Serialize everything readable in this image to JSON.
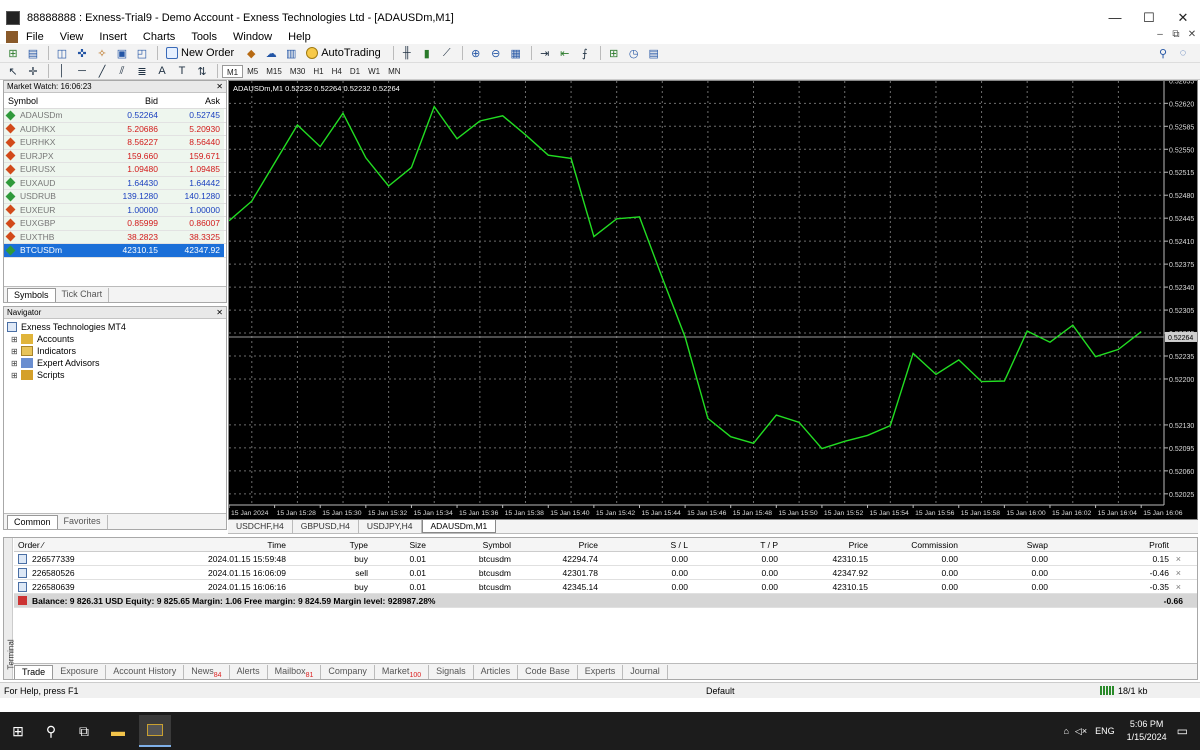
{
  "window": {
    "title": "88888888 : Exness-Trial9 - Demo Account - Exness Technologies Ltd - [ADAUSDm,M1]",
    "controls": [
      "—",
      "☐",
      "✕"
    ]
  },
  "menu": [
    "File",
    "View",
    "Insert",
    "Charts",
    "Tools",
    "Window",
    "Help"
  ],
  "toolbar": {
    "new_order": "New Order",
    "autotrading": "AutoTrading",
    "timeframes": [
      "M1",
      "M5",
      "M15",
      "M30",
      "H1",
      "H4",
      "D1",
      "W1",
      "MN"
    ]
  },
  "market_watch": {
    "title": "Market Watch: 16:06:23",
    "columns": [
      "Symbol",
      "Bid",
      "Ask"
    ],
    "rows": [
      {
        "symbol": "ADAUSDm",
        "bid": "0.52264",
        "ask": "0.52745",
        "color": "#2e9a3a",
        "bid_color": "#1a3fbf",
        "ask_color": "#1a3fbf"
      },
      {
        "symbol": "AUDHKX",
        "bid": "5.20686",
        "ask": "5.20930",
        "color": "#d24a1a",
        "bid_color": "#d21a1a",
        "ask_color": "#d21a1a"
      },
      {
        "symbol": "EURHKX",
        "bid": "8.56227",
        "ask": "8.56440",
        "color": "#d24a1a",
        "bid_color": "#d21a1a",
        "ask_color": "#d21a1a"
      },
      {
        "symbol": "EURJPX",
        "bid": "159.660",
        "ask": "159.671",
        "color": "#d24a1a",
        "bid_color": "#d21a1a",
        "ask_color": "#d21a1a"
      },
      {
        "symbol": "EURUSX",
        "bid": "1.09480",
        "ask": "1.09485",
        "color": "#d24a1a",
        "bid_color": "#d21a1a",
        "ask_color": "#d21a1a"
      },
      {
        "symbol": "EUXAUD",
        "bid": "1.64430",
        "ask": "1.64442",
        "color": "#2e9a3a",
        "bid_color": "#1a3fbf",
        "ask_color": "#1a3fbf"
      },
      {
        "symbol": "USDRUB",
        "bid": "139.1280",
        "ask": "140.1280",
        "color": "#2e9a3a",
        "bid_color": "#1a3fbf",
        "ask_color": "#1a3fbf"
      },
      {
        "symbol": "EUXEUR",
        "bid": "1.00000",
        "ask": "1.00000",
        "color": "#d24a1a",
        "bid_color": "#1a3fbf",
        "ask_color": "#1a3fbf"
      },
      {
        "symbol": "EUXGBP",
        "bid": "0.85999",
        "ask": "0.86007",
        "color": "#d24a1a",
        "bid_color": "#d21a1a",
        "ask_color": "#d21a1a"
      },
      {
        "symbol": "EUXTHB",
        "bid": "38.2823",
        "ask": "38.3325",
        "color": "#d24a1a",
        "bid_color": "#d21a1a",
        "ask_color": "#d21a1a"
      },
      {
        "symbol": "BTCUSDm",
        "bid": "42310.15",
        "ask": "42347.92",
        "color": "#2e9a3a",
        "bid_color": "#ffffff",
        "ask_color": "#ffffff",
        "selected": true
      }
    ],
    "tabs": [
      "Symbols",
      "Tick Chart"
    ]
  },
  "navigator": {
    "title": "Navigator",
    "root": "Exness Technologies MT4",
    "items": [
      "Accounts",
      "Indicators",
      "Expert Advisors",
      "Scripts"
    ],
    "tabs": [
      "Common",
      "Favorites"
    ]
  },
  "chart": {
    "header": "ADAUSDm,M1  0.52232 0.52264 0.52232 0.52264",
    "current_price": "0.52264",
    "line_color": "#22dd22"
  },
  "chart_data": {
    "type": "line",
    "ylim": [
      0.52008,
      0.52654
    ],
    "y_ticks": [
      "0.52655",
      "0.52620",
      "0.52585",
      "0.52550",
      "0.52515",
      "0.52480",
      "0.52445",
      "0.52410",
      "0.52375",
      "0.52340",
      "0.52305",
      "0.52270",
      "0.52235",
      "0.52200",
      "0.52130",
      "0.52095",
      "0.52060",
      "0.52025"
    ],
    "y_tick_values": [
      0.52655,
      0.5262,
      0.52585,
      0.5255,
      0.52515,
      0.5248,
      0.52445,
      0.5241,
      0.52375,
      0.5234,
      0.52305,
      0.5227,
      0.52235,
      0.522,
      0.5213,
      0.52095,
      0.5206,
      0.52025
    ],
    "x_ticks": [
      "15 Jan 2024",
      "15 Jan 15:28",
      "15 Jan 15:30",
      "15 Jan 15:32",
      "15 Jan 15:34",
      "15 Jan 15:36",
      "15 Jan 15:38",
      "15 Jan 15:40",
      "15 Jan 15:42",
      "15 Jan 15:44",
      "15 Jan 15:46",
      "15 Jan 15:48",
      "15 Jan 15:50",
      "15 Jan 15:52",
      "15 Jan 15:54",
      "15 Jan 15:56",
      "15 Jan 15:58",
      "15 Jan 16:00",
      "15 Jan 16:02",
      "15 Jan 16:04",
      "15 Jan 16:06"
    ],
    "x_minutes": [
      "15:25",
      "15:26",
      "15:27",
      "15:28",
      "15:29",
      "15:30",
      "15:31",
      "15:32",
      "15:33",
      "15:34",
      "15:35",
      "15:36",
      "15:37",
      "15:38",
      "15:39",
      "15:40",
      "15:41",
      "15:42",
      "15:43",
      "15:44",
      "15:45",
      "15:46",
      "15:47",
      "15:48",
      "15:49",
      "15:50",
      "15:51",
      "15:52",
      "15:53",
      "15:54",
      "15:55",
      "15:56",
      "15:57",
      "15:58",
      "15:59",
      "16:00",
      "16:01",
      "16:02",
      "16:03",
      "16:04",
      "16:05",
      "16:06"
    ],
    "values": [
      0.52441,
      0.52471,
      0.52529,
      0.52587,
      0.52554,
      0.52605,
      0.52537,
      0.52494,
      0.52522,
      0.52615,
      0.52566,
      0.52593,
      0.52601,
      0.52572,
      0.52541,
      0.52536,
      0.52417,
      0.52444,
      0.52447,
      0.52354,
      0.52264,
      0.5214,
      0.52112,
      0.52102,
      0.52145,
      0.52134,
      0.52094,
      0.52105,
      0.52114,
      0.52129,
      0.52239,
      0.52207,
      0.52229,
      0.52196,
      0.52197,
      0.52273,
      0.52256,
      0.52282,
      0.52234,
      0.52245,
      0.52272
    ],
    "grid": true
  },
  "chart_tabs": [
    "USDCHF,H4",
    "GBPUSD,H4",
    "USDJPY,H4",
    "ADAUSDm,M1"
  ],
  "terminal": {
    "side_label": "Terminal",
    "columns": [
      "Order",
      "Time",
      "Type",
      "Size",
      "Symbol",
      "Price",
      "S / L",
      "T / P",
      "Price",
      "Commission",
      "Swap",
      "Profit"
    ],
    "rows": [
      {
        "order": "226577339",
        "time": "2024.01.15 15:59:48",
        "type": "buy",
        "size": "0.01",
        "symbol": "btcusdm",
        "price": "42294.74",
        "sl": "0.00",
        "tp": "0.00",
        "price2": "42310.15",
        "commission": "0.00",
        "swap": "0.00",
        "profit": "0.15"
      },
      {
        "order": "226580526",
        "time": "2024.01.15 16:06:09",
        "type": "sell",
        "size": "0.01",
        "symbol": "btcusdm",
        "price": "42301.78",
        "sl": "0.00",
        "tp": "0.00",
        "price2": "42347.92",
        "commission": "0.00",
        "swap": "0.00",
        "profit": "-0.46"
      },
      {
        "order": "226580639",
        "time": "2024.01.15 16:06:16",
        "type": "buy",
        "size": "0.01",
        "symbol": "btcusdm",
        "price": "42345.14",
        "sl": "0.00",
        "tp": "0.00",
        "price2": "42310.15",
        "commission": "0.00",
        "swap": "0.00",
        "profit": "-0.35"
      }
    ],
    "balance_line": "Balance: 9 826.31 USD  Equity: 9 825.65  Margin: 1.06  Free margin: 9 824.59  Margin level: 928987.28%",
    "total_profit": "-0.66",
    "tabs": [
      {
        "label": "Trade",
        "badge": ""
      },
      {
        "label": "Exposure",
        "badge": ""
      },
      {
        "label": "Account History",
        "badge": ""
      },
      {
        "label": "News",
        "badge": "84"
      },
      {
        "label": "Alerts",
        "badge": ""
      },
      {
        "label": "Mailbox",
        "badge": "81"
      },
      {
        "label": "Company",
        "badge": ""
      },
      {
        "label": "Market",
        "badge": "100"
      },
      {
        "label": "Signals",
        "badge": ""
      },
      {
        "label": "Articles",
        "badge": ""
      },
      {
        "label": "Code Base",
        "badge": ""
      },
      {
        "label": "Experts",
        "badge": ""
      },
      {
        "label": "Journal",
        "badge": ""
      }
    ]
  },
  "status": {
    "help": "For Help, press F1",
    "profile": "Default",
    "traffic": "18/1 kb"
  },
  "taskbar": {
    "lang": "ENG",
    "time": "5:06 PM",
    "date": "1/15/2024"
  }
}
